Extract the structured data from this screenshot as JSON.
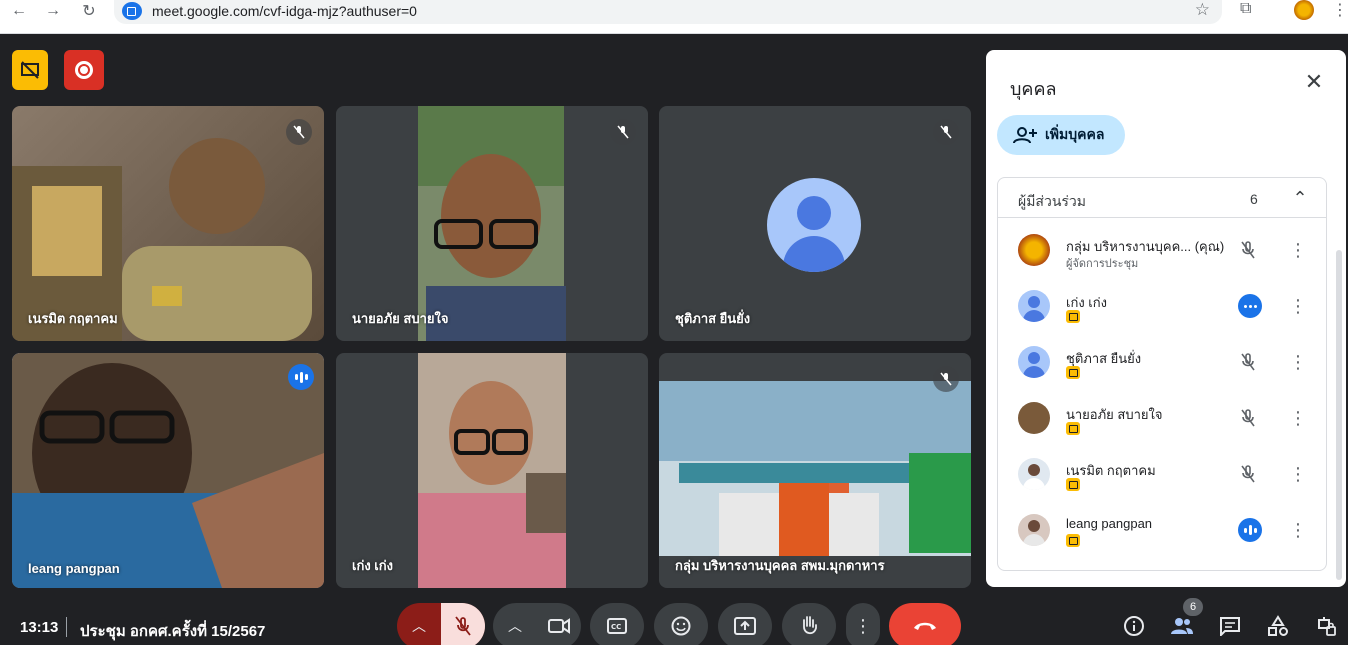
{
  "browser": {
    "url": "meet.google.com/cvf-idga-mjz?authuser=0"
  },
  "meeting": {
    "time": "13:13",
    "title": "ประชุม อกคศ.ครั้งที่ 15/2567"
  },
  "tiles": [
    {
      "name": "เนรมิต กฤตาคม"
    },
    {
      "name": "นายอภัย สบายใจ"
    },
    {
      "name": "ชุติภาส ยืนยั่ง"
    },
    {
      "name": "leang pangpan"
    },
    {
      "name": "เก่ง เก่ง"
    },
    {
      "name": "กลุ่ม บริหารงานบุคคล สพม.มุกดาหาร"
    }
  ],
  "panel": {
    "title": "บุคคล",
    "add_label": "เพิ่มบุคคล",
    "group_title": "ผู้มีส่วนร่วม",
    "group_count": "6",
    "participants": [
      {
        "name": "กลุ่ม บริหารงานบุคค...   (คุณ)",
        "role": "ผู้จัดการประชุม"
      },
      {
        "name": "เก่ง เก่ง"
      },
      {
        "name": "ชุติภาส ยืนยั่ง"
      },
      {
        "name": "นายอภัย สบายใจ"
      },
      {
        "name": "เนรมิต กฤตาคม"
      },
      {
        "name": "leang pangpan"
      }
    ]
  },
  "people_count": "6",
  "colors": {
    "background": "#202124",
    "accent": "#1a73e8",
    "end_call": "#ea4335",
    "record": "#d93025",
    "badge": "#fbbc04"
  }
}
